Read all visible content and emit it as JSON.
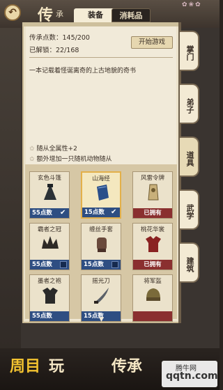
{
  "header": {
    "title_big": "传",
    "title_small": "承",
    "tabs": [
      {
        "label": "装备",
        "active": true
      },
      {
        "label": "消耗品",
        "active": false
      }
    ]
  },
  "info": {
    "points_line": "传承点数：145/200",
    "unlocked_line": "已解锁：22/168",
    "start_button": "开始游戏",
    "description": "一本记载着怪诞离奇的上古地貌的奇书",
    "bonuses": [
      "随从全属性+2",
      "额外增加一只随机动物随从"
    ]
  },
  "items": [
    {
      "name": "玄色斗篷",
      "foot": "55点数",
      "state": "checked",
      "icon": "cloak-icon"
    },
    {
      "name": "山海经",
      "foot": "15点数",
      "state": "checked",
      "icon": "book-icon",
      "selected": true
    },
    {
      "name": "风雷令牌",
      "foot": "已拥有",
      "state": "owned",
      "icon": "token-icon"
    },
    {
      "name": "霸者之冠",
      "foot": "55点数",
      "state": "empty",
      "icon": "crown-icon"
    },
    {
      "name": "缠丝手套",
      "foot": "15点数",
      "state": "empty",
      "icon": "glove-icon"
    },
    {
      "name": "桃花华裳",
      "foot": "已拥有",
      "state": "owned",
      "icon": "robe-icon"
    },
    {
      "name": "墨者之袍",
      "foot": "55点数",
      "state": "empty",
      "icon": "robe-dark-icon"
    },
    {
      "name": "摇光刀",
      "foot": "15点数",
      "state": "empty",
      "icon": "blade-icon"
    },
    {
      "name": "将军盔",
      "foot": "",
      "state": "owned",
      "icon": "helmet-icon"
    }
  ],
  "side_tabs": [
    "掌门",
    "弟子",
    "道具",
    "武学",
    "建筑"
  ],
  "side_tab_active": 2,
  "banner": {
    "part1": "周目",
    "part2": "玩",
    "part3": "传承",
    "watermark_a": "腾牛网",
    "watermark_b": "qqtn.com"
  },
  "colors": {
    "parchment": "#f1ead9",
    "points_blue": "#2e4e82",
    "owned_red": "#8a2f2f",
    "selected_gold": "#e3b04a",
    "banner_yellow": "#f2c230"
  }
}
